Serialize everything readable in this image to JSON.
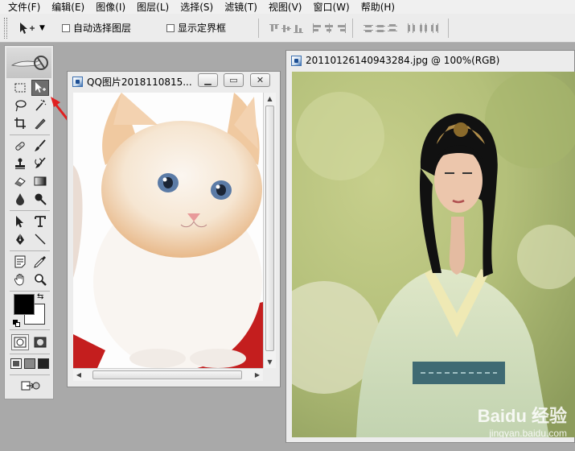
{
  "menu": [
    "文件(F)",
    "编辑(E)",
    "图像(I)",
    "图层(L)",
    "选择(S)",
    "滤镜(T)",
    "视图(V)",
    "窗口(W)",
    "帮助(H)"
  ],
  "options": {
    "auto_select_layer": "自动选择图层",
    "show_bounding_box": "显示定界框"
  },
  "tools": [
    "rectangular-marquee",
    "move",
    "lasso",
    "magic-wand",
    "crop",
    "slice",
    "healing-brush",
    "brush",
    "clone-stamp",
    "history-brush",
    "eraser",
    "gradient",
    "blur",
    "dodge",
    "path-selection",
    "type",
    "pen",
    "line",
    "notes",
    "eyedropper",
    "hand",
    "zoom"
  ],
  "colors": {
    "foreground": "#000000",
    "background": "#ffffff",
    "accent_arrow": "#e02020"
  },
  "doc1": {
    "title": "QQ图片2018110815..."
  },
  "doc2": {
    "title": "20110126140943284.jpg @ 100%(RGB)"
  },
  "watermark": {
    "brand": "Baidu 经验",
    "url": "jingyan.baidu.com"
  }
}
